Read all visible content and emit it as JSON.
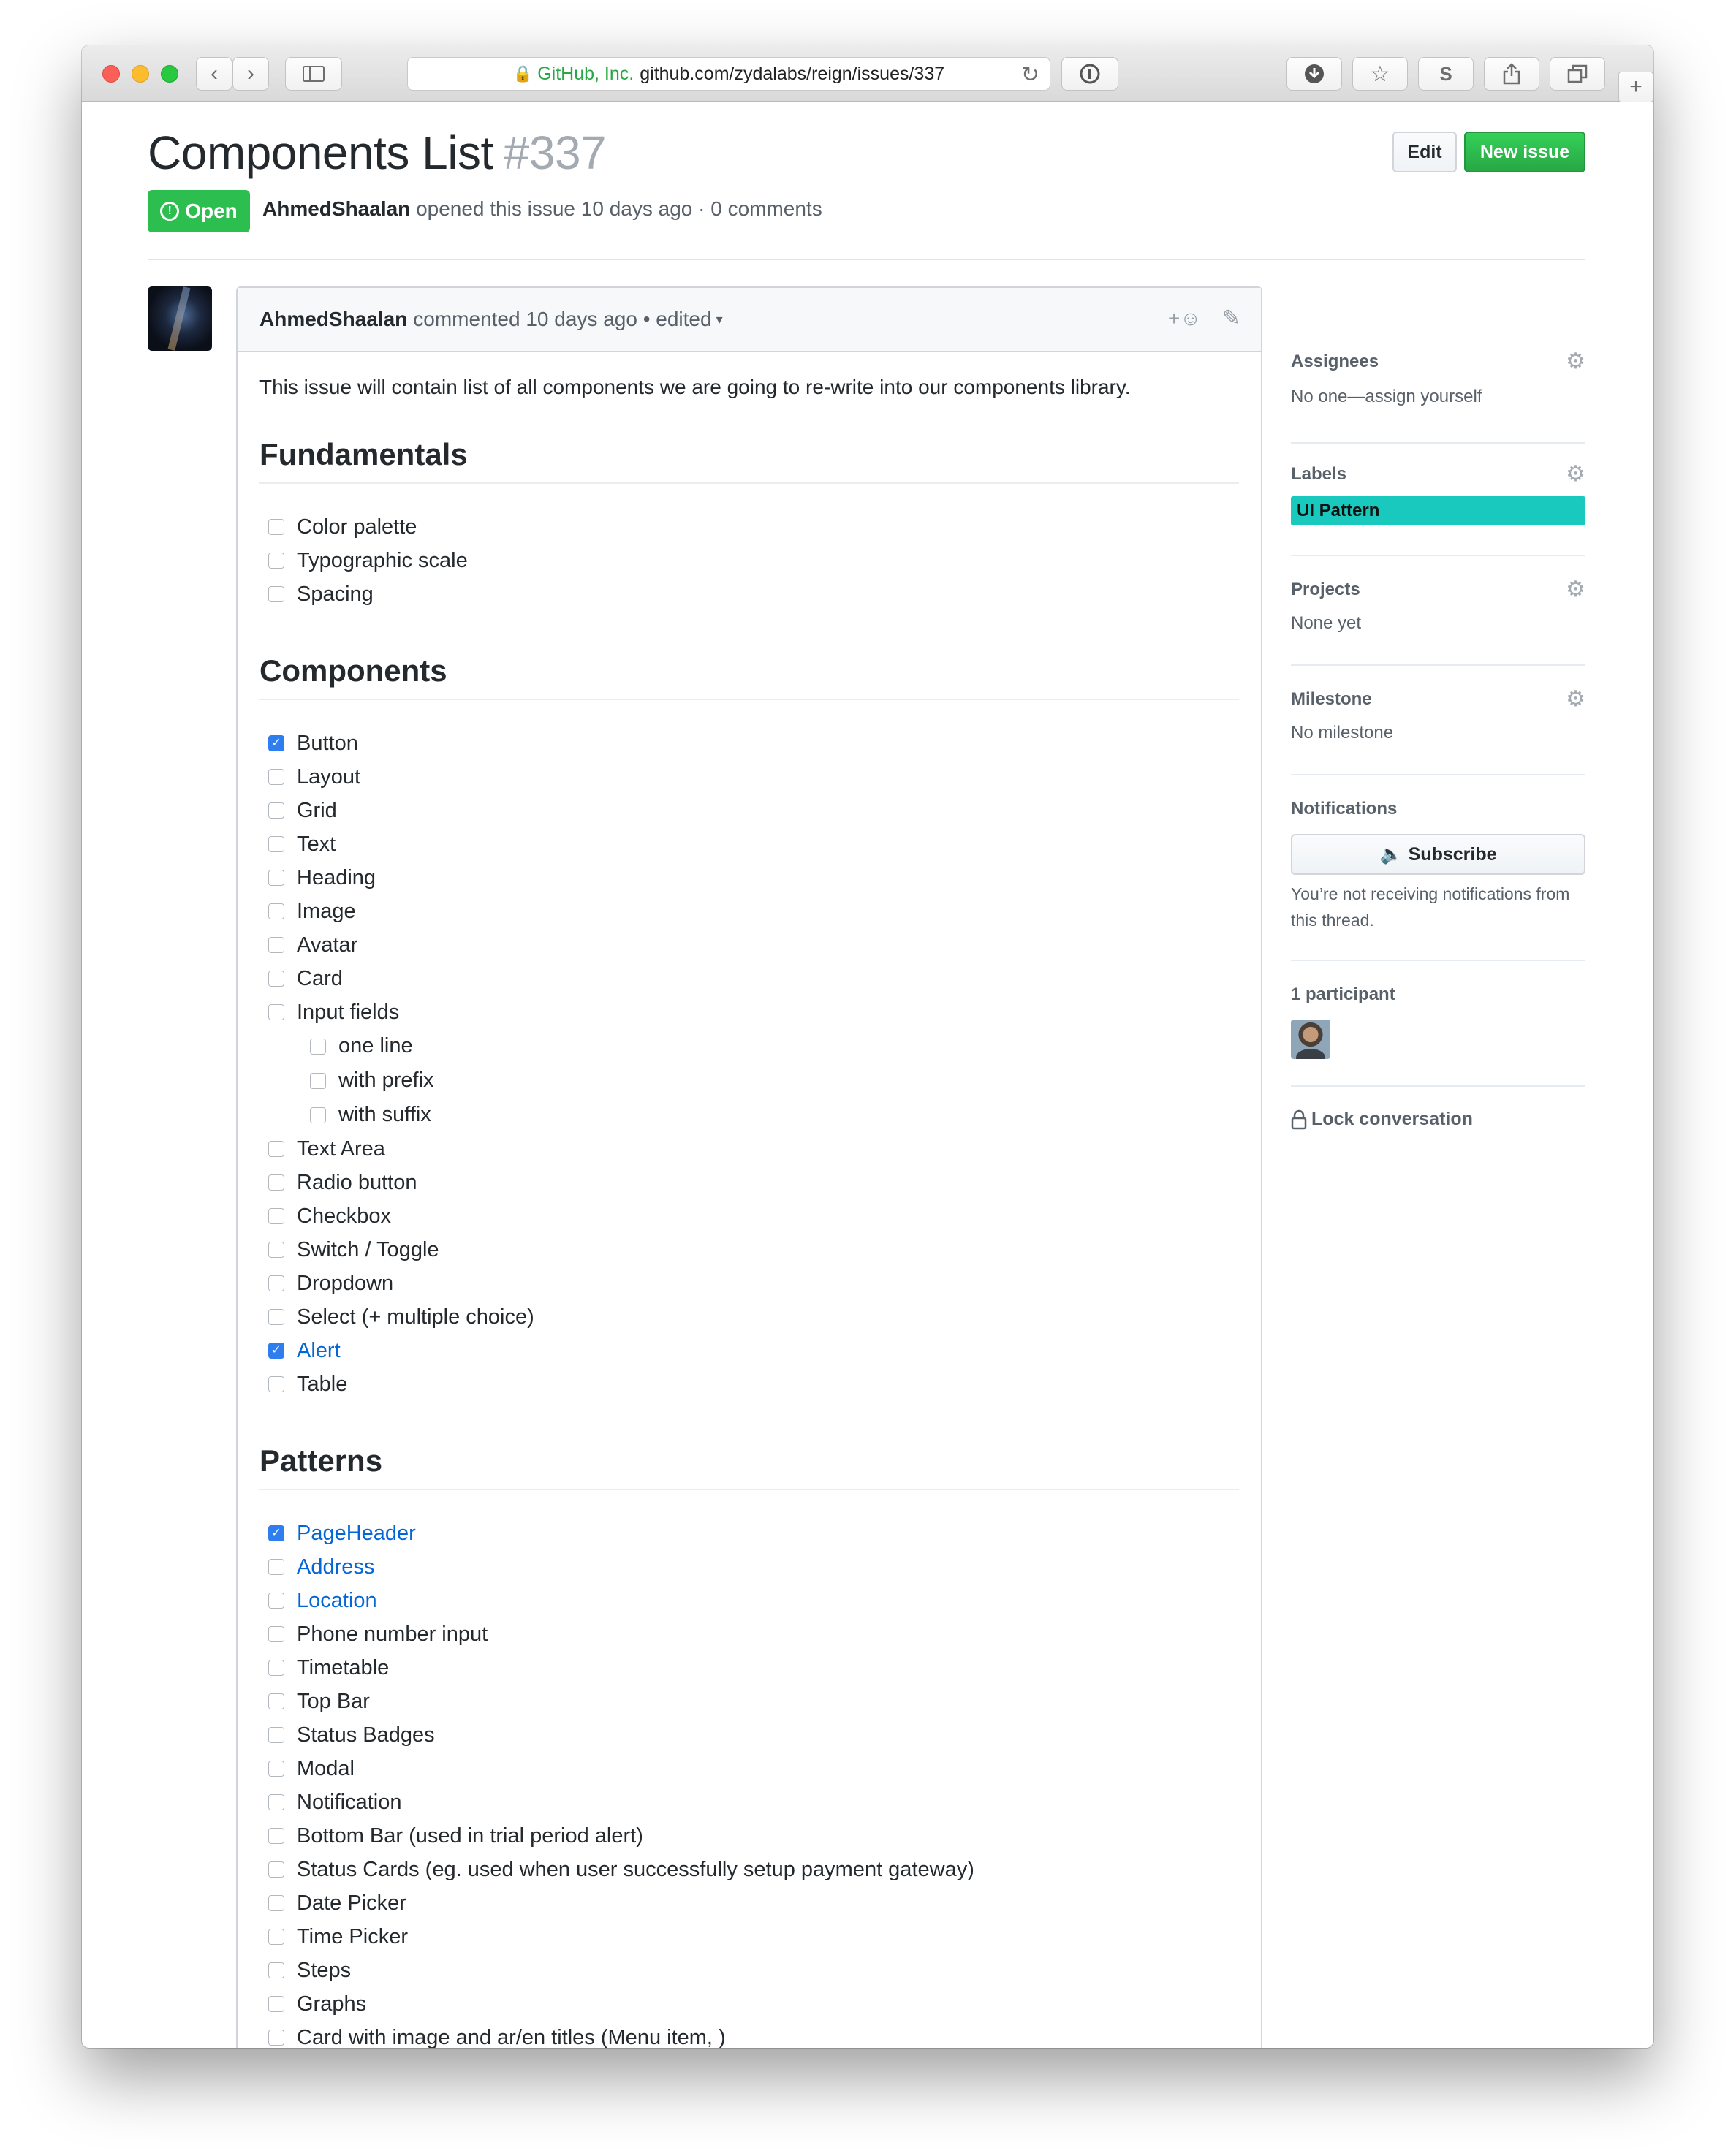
{
  "browser": {
    "url_cert": "GitHub, Inc.",
    "url_text": "github.com/zydalabs/reign/issues/337",
    "extension_label": "S"
  },
  "issue": {
    "title": "Components List",
    "number": "#337",
    "state": "Open",
    "author": "AhmedShaalan",
    "meta_text": "opened this issue 10 days ago · 0 comments",
    "edit_label": "Edit",
    "new_issue_label": "New issue"
  },
  "comment": {
    "author": "AhmedShaalan",
    "meta": "commented 10 days ago • edited",
    "intro": "This issue will contain list of all components we are going to re-write into our components library.",
    "sections": [
      {
        "heading": "Fundamentals",
        "tasks": [
          {
            "label": "Color palette",
            "checked": false
          },
          {
            "label": "Typographic scale",
            "checked": false
          },
          {
            "label": "Spacing",
            "checked": false
          }
        ]
      },
      {
        "heading": "Components",
        "tasks": [
          {
            "label": "Button",
            "checked": true
          },
          {
            "label": "Layout",
            "checked": false
          },
          {
            "label": "Grid",
            "checked": false
          },
          {
            "label": "Text",
            "checked": false
          },
          {
            "label": "Heading",
            "checked": false
          },
          {
            "label": "Image",
            "checked": false
          },
          {
            "label": "Avatar",
            "checked": false
          },
          {
            "label": "Card",
            "checked": false
          },
          {
            "label": "Input fields",
            "checked": false
          },
          {
            "label": "one line",
            "checked": false,
            "sub": true
          },
          {
            "label": "with prefix",
            "checked": false,
            "sub": true
          },
          {
            "label": "with suffix",
            "checked": false,
            "sub": true
          },
          {
            "label": "Text Area",
            "checked": false
          },
          {
            "label": "Radio button",
            "checked": false
          },
          {
            "label": "Checkbox",
            "checked": false
          },
          {
            "label": "Switch / Toggle",
            "checked": false
          },
          {
            "label": "Dropdown",
            "checked": false
          },
          {
            "label": "Select (+ multiple choice)",
            "checked": false
          },
          {
            "label": "Alert",
            "checked": true,
            "link": true
          },
          {
            "label": "Table",
            "checked": false
          }
        ]
      },
      {
        "heading": "Patterns",
        "tasks": [
          {
            "label": "PageHeader",
            "checked": true,
            "link": true
          },
          {
            "label": "Address",
            "checked": false,
            "link": true
          },
          {
            "label": "Location",
            "checked": false,
            "link": true
          },
          {
            "label": "Phone number input",
            "checked": false
          },
          {
            "label": "Timetable",
            "checked": false
          },
          {
            "label": "Top Bar",
            "checked": false
          },
          {
            "label": "Status Badges",
            "checked": false
          },
          {
            "label": "Modal",
            "checked": false
          },
          {
            "label": "Notification",
            "checked": false
          },
          {
            "label": "Bottom Bar (used in trial period alert)",
            "checked": false
          },
          {
            "label": "Status Cards (eg. used when user successfully setup payment gateway)",
            "checked": false
          },
          {
            "label": "Date Picker",
            "checked": false
          },
          {
            "label": "Time Picker",
            "checked": false
          },
          {
            "label": "Steps",
            "checked": false
          },
          {
            "label": "Graphs",
            "checked": false
          },
          {
            "label": "Card with image and ar/en titles (Menu item, )",
            "checked": false
          }
        ]
      }
    ]
  },
  "sidebar": {
    "assignees_title": "Assignees",
    "assignees_value": "No one—assign yourself",
    "labels_title": "Labels",
    "label_name": "UI Pattern",
    "label_color": "#19c9be",
    "projects_title": "Projects",
    "projects_value": "None yet",
    "milestone_title": "Milestone",
    "milestone_value": "No milestone",
    "notifications_title": "Notifications",
    "subscribe_label": "Subscribe",
    "notifications_text": "You’re not receiving notifications from this thread.",
    "participants_title": "1 participant",
    "lock_label": "Lock conversation"
  },
  "colors": {
    "open_green": "#2cbe4e",
    "link_blue": "#0366d6",
    "checkbox_blue": "#2e7ef0"
  }
}
